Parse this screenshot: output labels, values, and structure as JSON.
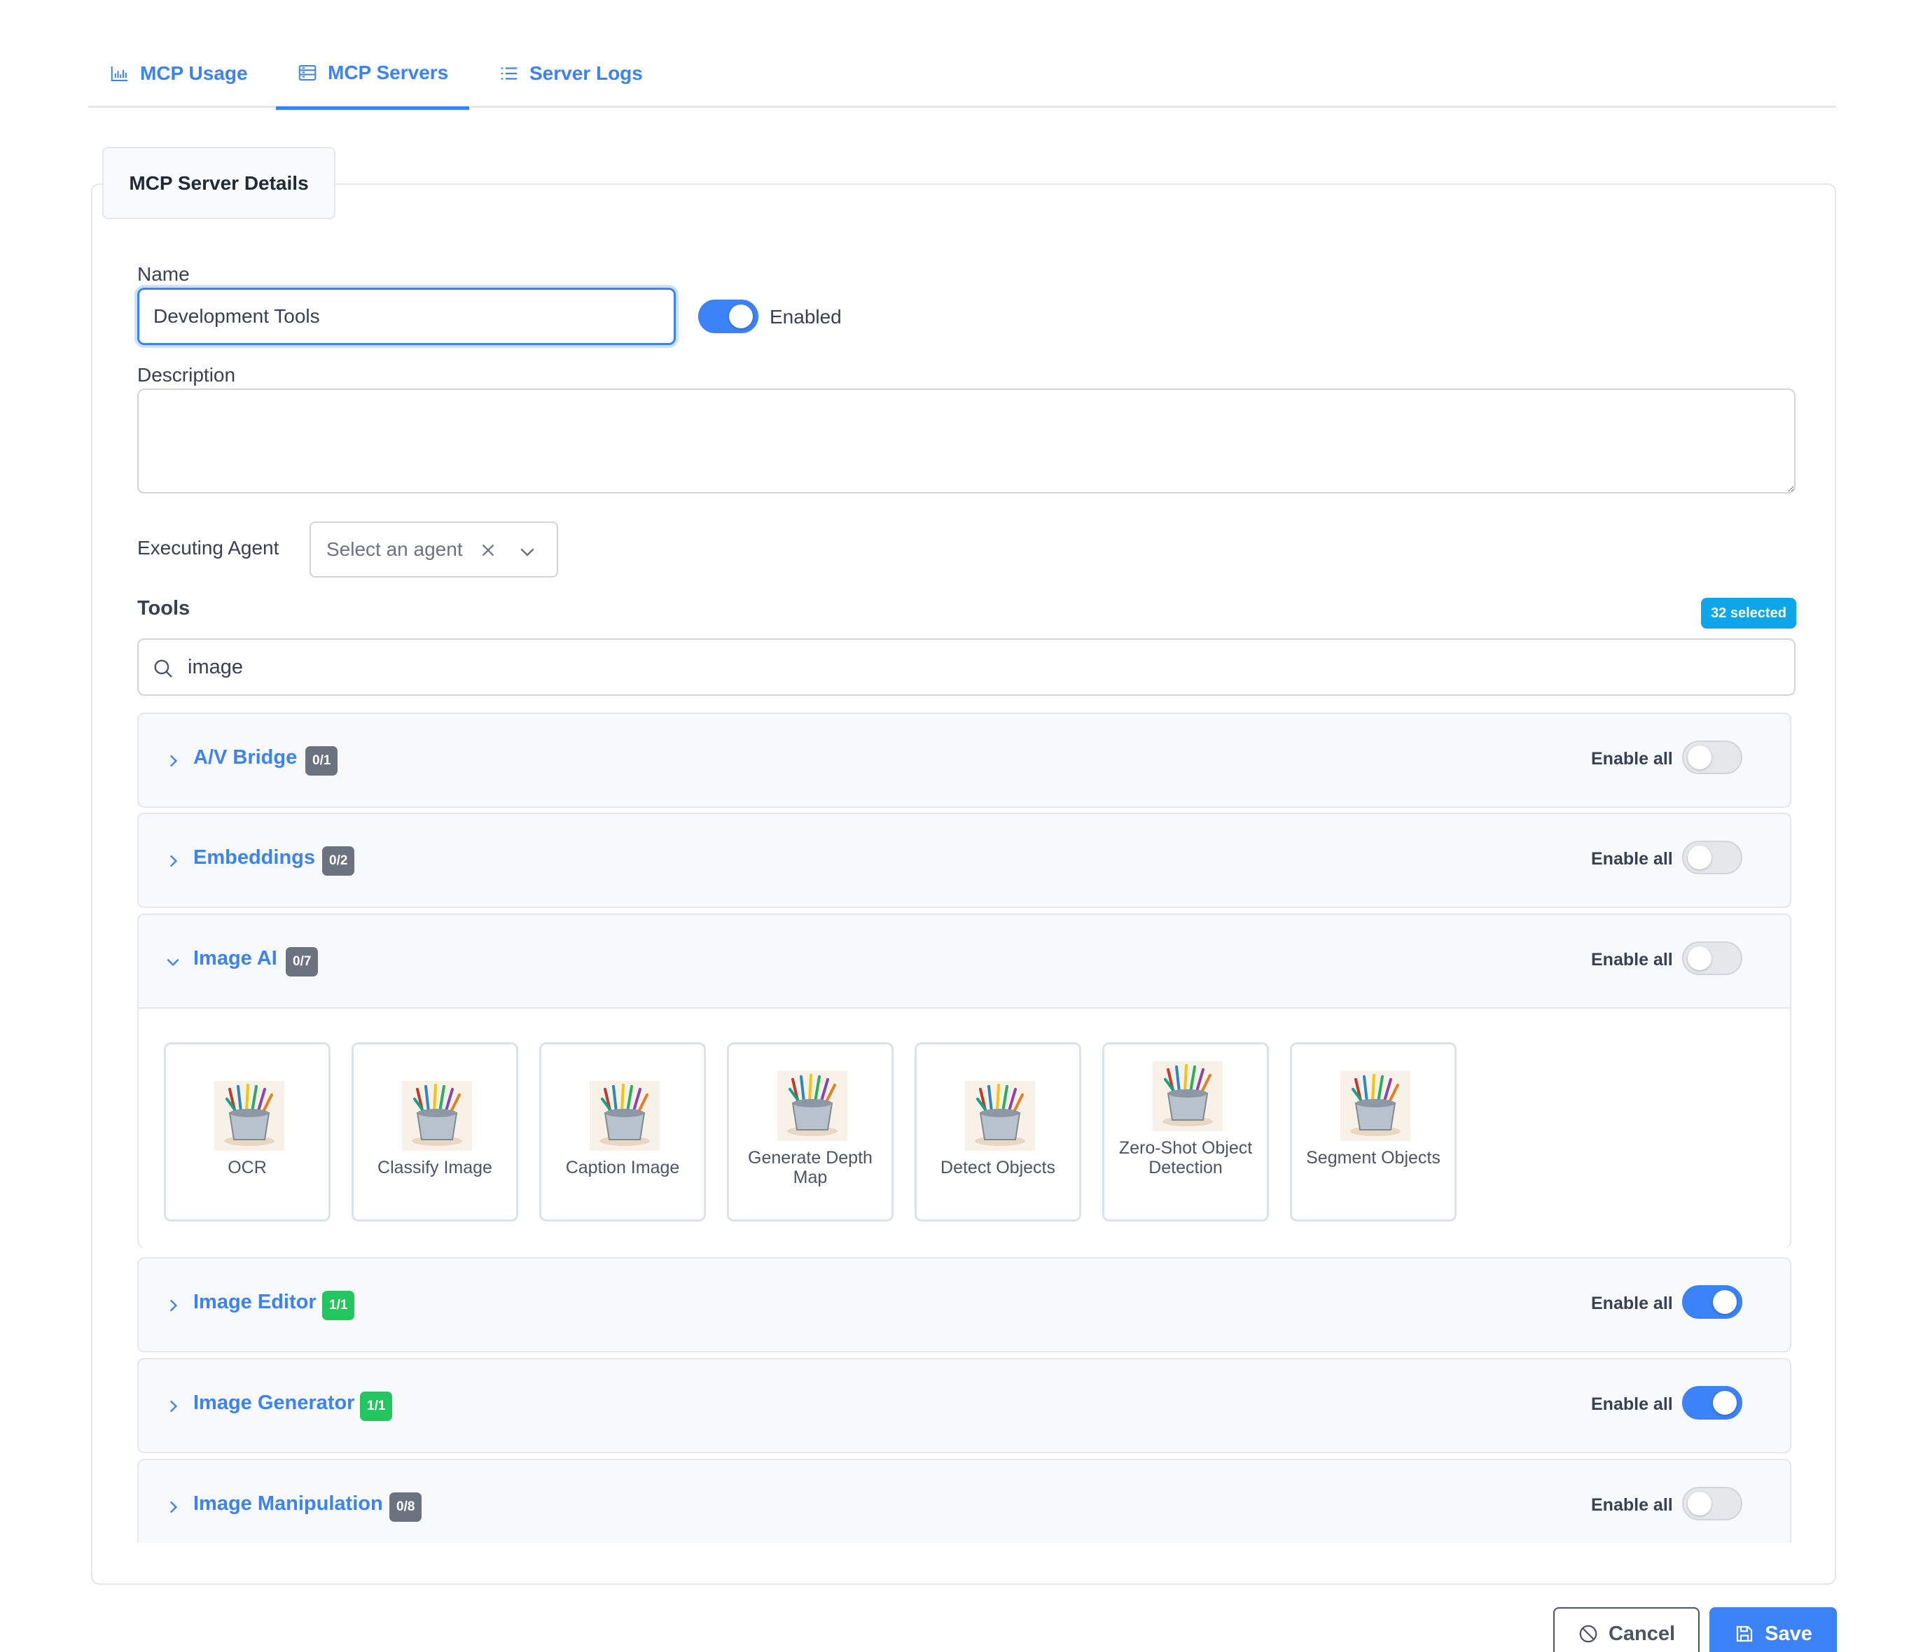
{
  "tabs": [
    {
      "label": "MCP Usage",
      "icon": "bar-chart-icon"
    },
    {
      "label": "MCP Servers",
      "icon": "server-icon",
      "active": true
    },
    {
      "label": "Server Logs",
      "icon": "list-icon"
    }
  ],
  "card": {
    "title": "MCP Server Details"
  },
  "form": {
    "name_label": "Name",
    "name_value": "Development Tools",
    "enabled_label": "Enabled",
    "enabled": true,
    "description_label": "Description",
    "description_value": "",
    "agent_label": "Executing Agent",
    "agent_placeholder": "Select an agent"
  },
  "tools": {
    "label": "Tools",
    "selected_badge": "32 selected",
    "search_value": "image",
    "enable_all_label": "Enable all",
    "groups": [
      {
        "name": "A/V Bridge",
        "count": "0/1",
        "expanded": false,
        "enabled": false
      },
      {
        "name": "Embeddings",
        "count": "0/2",
        "expanded": false,
        "enabled": false
      },
      {
        "name": "Image AI",
        "count": "0/7",
        "expanded": true,
        "enabled": false,
        "items": [
          "OCR",
          "Classify Image",
          "Caption Image",
          "Generate Depth Map",
          "Detect Objects",
          "Zero-Shot Object Detection",
          "Segment Objects"
        ]
      },
      {
        "name": "Image Editor",
        "count": "1/1",
        "expanded": false,
        "enabled": true
      },
      {
        "name": "Image Generator",
        "count": "1/1",
        "expanded": false,
        "enabled": true
      },
      {
        "name": "Image Manipulation",
        "count": "0/8",
        "expanded": false,
        "enabled": false
      }
    ]
  },
  "actions": {
    "cancel_label": "Cancel",
    "save_label": "Save"
  },
  "colors": {
    "accent": "#3b82f6",
    "badge_gray": "#6b7280",
    "badge_green": "#22c55e",
    "selected_badge": "#0ea5e9"
  }
}
